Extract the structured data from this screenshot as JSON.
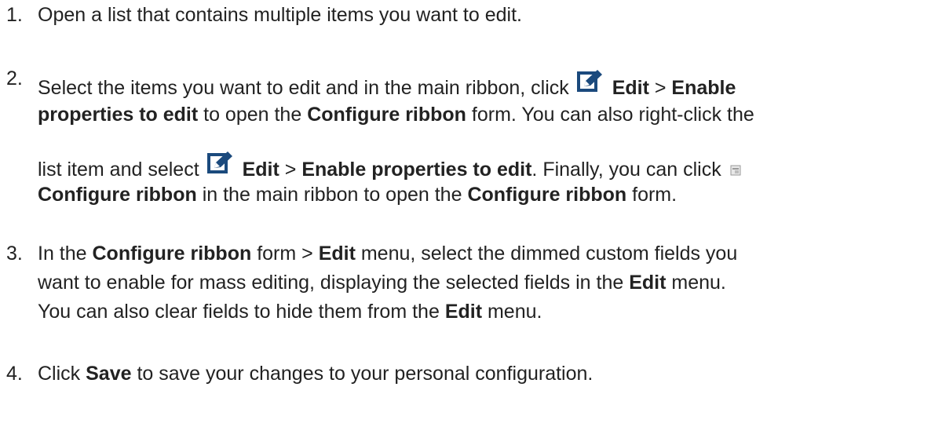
{
  "steps": [
    {
      "num": "1.",
      "lines": [
        [
          {
            "t": "Open a list that contains multiple items you want to edit."
          }
        ]
      ]
    },
    {
      "num": "2.",
      "lines": [
        [
          {
            "t": "Select the items you want to edit and in the main ribbon, click "
          },
          {
            "icon": "edit-icon"
          },
          {
            "t": "Edit",
            "b": true
          },
          {
            "t": " > "
          },
          {
            "t": "Enable",
            "b": true
          }
        ],
        [
          {
            "t": "properties to edit",
            "b": true
          },
          {
            "t": " to open the "
          },
          {
            "t": "Configure ribbon",
            "b": true
          },
          {
            "t": " form. You can also right-click the"
          }
        ],
        [
          {
            "t": "list item and select "
          },
          {
            "icon": "edit-icon"
          },
          {
            "t": "Edit",
            "b": true
          },
          {
            "t": " > "
          },
          {
            "t": "Enable properties to edit",
            "b": true
          },
          {
            "t": ". Finally, you can click "
          },
          {
            "icon": "configure-ribbon-icon"
          }
        ],
        [
          {
            "t": "Configure ribbon",
            "b": true
          },
          {
            "t": " in the main ribbon to open the "
          },
          {
            "t": "Configure ribbon",
            "b": true
          },
          {
            "t": " form."
          }
        ]
      ]
    },
    {
      "num": "3.",
      "lines": [
        [
          {
            "t": "In the "
          },
          {
            "t": "Configure ribbon",
            "b": true
          },
          {
            "t": " form > "
          },
          {
            "t": "Edit",
            "b": true
          },
          {
            "t": " menu, select the dimmed custom fields you"
          }
        ],
        [
          {
            "t": "want to enable for mass editing, displaying the selected fields in the "
          },
          {
            "t": "Edit",
            "b": true
          },
          {
            "t": " menu."
          }
        ],
        [
          {
            "t": "You can also clear fields to hide them from the "
          },
          {
            "t": "Edit",
            "b": true
          },
          {
            "t": " menu."
          }
        ]
      ]
    },
    {
      "num": "4.",
      "lines": [
        [
          {
            "t": "Click "
          },
          {
            "t": "Save",
            "b": true
          },
          {
            "t": " to save your changes to your personal configuration."
          }
        ]
      ]
    }
  ]
}
